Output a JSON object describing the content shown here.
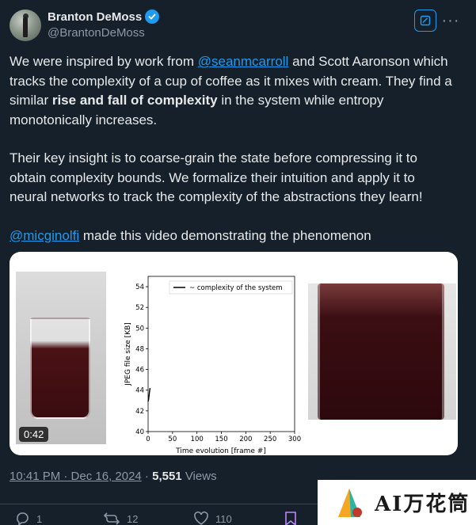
{
  "author": {
    "name": "Branton DeMoss",
    "handle": "@BrantonDeMoss"
  },
  "tweet": {
    "p1_a": "We were inspired by work from ",
    "p1_mention": "@seanmcarroll",
    "p1_b": " and Scott Aaronson which tracks the complexity of a cup of coffee as it mixes with cream. They find a similar ",
    "p1_bold": "rise and fall of complexity",
    "p1_c": " in the system while entropy monotonically increases.",
    "p2": "Their key insight is to coarse-grain the state before compressing it to obtain complexity bounds. We formalize their intuition and apply it to neural networks to track the complexity of the abstractions they learn!",
    "p3_mention": "@micginolfi",
    "p3_rest": " made this video demonstrating the phenomenon"
  },
  "media": {
    "video_time": "0:42"
  },
  "chart_data": {
    "type": "line",
    "xlabel": "Time evolution [frame #]",
    "ylabel": "JPEG file size [KB]",
    "xlim": [
      0,
      300
    ],
    "ylim": [
      40,
      55
    ],
    "xticks": [
      "0",
      "50",
      "100",
      "150",
      "200",
      "250",
      "300"
    ],
    "yticks": [
      "40",
      "42",
      "44",
      "46",
      "48",
      "50",
      "52",
      "54"
    ],
    "legend_position": "top-right",
    "series": [
      {
        "name": "~ complexity of the system",
        "color": "#000000",
        "x": [
          0,
          1,
          2,
          3,
          4
        ],
        "y": [
          42.9,
          43.1,
          43.5,
          43.9,
          44.2
        ]
      }
    ]
  },
  "meta": {
    "time": "10:41 PM · Dec 16, 2024",
    "sep": " · ",
    "views_count": "5,551",
    "views_label": " Views"
  },
  "actions": {
    "reply_count": "1",
    "retweet_count": "12",
    "like_count": "110"
  },
  "watermark": {
    "text": "AI万花筒"
  },
  "colors": {
    "background": "#15202b",
    "accent": "#1d9bf0",
    "muted": "#8b98a5"
  }
}
